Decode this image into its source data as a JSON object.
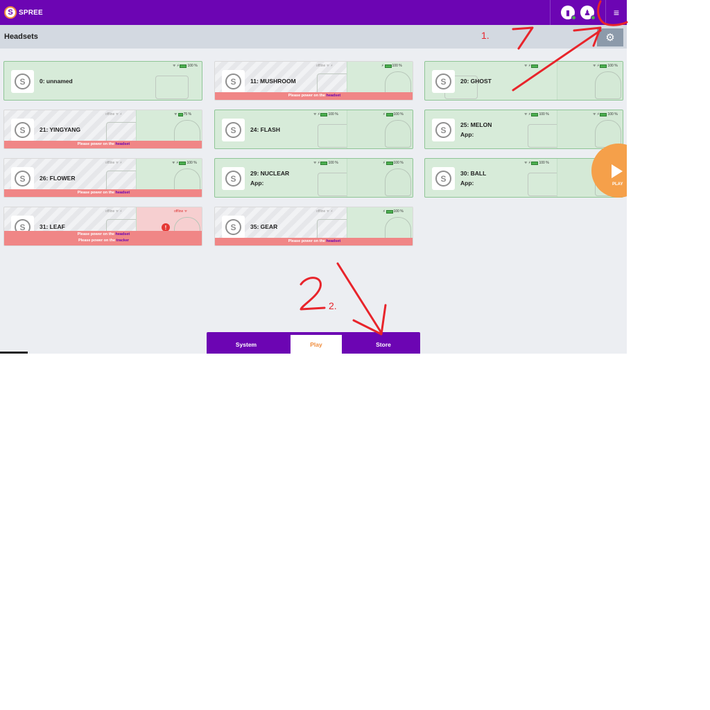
{
  "brand": {
    "logo_letter": "S",
    "name": "SPREE",
    "accent": "#6c05b3",
    "orange": "#f08c3c"
  },
  "header": {
    "icons": [
      "tracker-status-icon",
      "user-status-icon"
    ],
    "menu_glyph": "≡"
  },
  "subheader": {
    "title": "Headsets",
    "settings_glyph": "⚙"
  },
  "warning": {
    "prefix": "Please power on the",
    "headset": "headset",
    "tracker": "tracker"
  },
  "offline_label": "offline",
  "cards": [
    {
      "name": "0: unnamed",
      "battery": "100 %"
    },
    {
      "name": "11: MUSHROOM",
      "battery": "100 %"
    },
    {
      "name": "20: GHOST",
      "battery": "100 %"
    },
    {
      "name": "21: YINGYANG",
      "battery": "75 %"
    },
    {
      "name": "24: FLASH",
      "battery": "100 %"
    },
    {
      "name": "25: MELON",
      "app": "App:",
      "battery": "100 %"
    },
    {
      "name": "26: FLOWER",
      "battery": "100 %"
    },
    {
      "name": "29: NUCLEAR",
      "app": "App:",
      "battery": "100 %"
    },
    {
      "name": "30: BALL",
      "app": "App:",
      "battery": "100 %"
    },
    {
      "name": "31: LEAF"
    },
    {
      "name": "35: GEAR",
      "battery": "100 %"
    }
  ],
  "play_button": {
    "label": "PLAY"
  },
  "tabs": {
    "system": "System",
    "play": "Play",
    "store": "Store",
    "active": "Play"
  },
  "annotations": {
    "one": "1.",
    "two": "2.",
    "color": "#e8242b"
  }
}
